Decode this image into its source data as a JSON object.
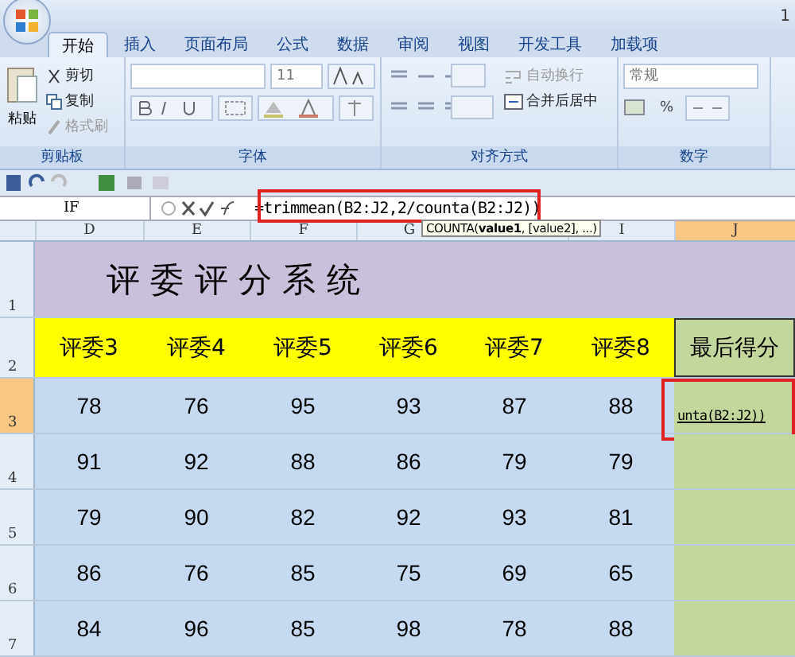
{
  "title_bar": {
    "page_number": "1"
  },
  "tabs": [
    {
      "label": "开始",
      "selected": true
    },
    {
      "label": "插入",
      "selected": false
    },
    {
      "label": "页面布局",
      "selected": false
    },
    {
      "label": "公式",
      "selected": false
    },
    {
      "label": "数据",
      "selected": false
    },
    {
      "label": "审阅",
      "selected": false
    },
    {
      "label": "视图",
      "selected": false
    },
    {
      "label": "开发工具",
      "selected": false
    },
    {
      "label": "加载项",
      "selected": false
    }
  ],
  "ribbon": {
    "clipboard": {
      "paste": "粘贴",
      "cut": "剪切",
      "copy": "复制",
      "format_painter": "格式刷",
      "label": "剪贴板"
    },
    "font": {
      "size": "11",
      "label": "字体"
    },
    "alignment": {
      "wrap": "自动换行",
      "merge": "合并后居中",
      "label": "对齐方式"
    },
    "number": {
      "format": "常规",
      "percent": "%",
      "label": "数字"
    }
  },
  "formula_bar": {
    "name_box": "IF",
    "formula": "=trimmean(B2:J2,2/counta(B2:J2))",
    "highlight": true,
    "tooltip": "COUNTA(**value1**, [value2], ...)"
  },
  "columns": [
    {
      "label": "D",
      "selected": false
    },
    {
      "label": "E",
      "selected": false
    },
    {
      "label": "F",
      "selected": false
    },
    {
      "label": "G",
      "selected": false
    },
    {
      "label": "I",
      "selected": false
    },
    {
      "label": "J",
      "selected": true
    }
  ],
  "title_row": "1",
  "header_row": "2",
  "title": "评 委 评 分 系 统",
  "headers": [
    "评委3",
    "评委4",
    "评委5",
    "评委6",
    "评委7",
    "评委8",
    "最后得分"
  ],
  "rows": [
    {
      "number": "3",
      "selected": true,
      "scores": [
        "78",
        "76",
        "95",
        "93",
        "87",
        "88"
      ],
      "result": "unta(B2:J2))",
      "highlight": true
    },
    {
      "number": "4",
      "selected": false,
      "scores": [
        "91",
        "92",
        "88",
        "86",
        "79",
        "79"
      ]
    },
    {
      "number": "5",
      "selected": false,
      "scores": [
        "79",
        "90",
        "82",
        "92",
        "93",
        "81"
      ]
    },
    {
      "number": "6",
      "selected": false,
      "scores": [
        "86",
        "76",
        "85",
        "75",
        "69",
        "65"
      ]
    },
    {
      "number": "7",
      "selected": false,
      "scores": [
        "84",
        "96",
        "85",
        "98",
        "78",
        "88"
      ]
    }
  ]
}
